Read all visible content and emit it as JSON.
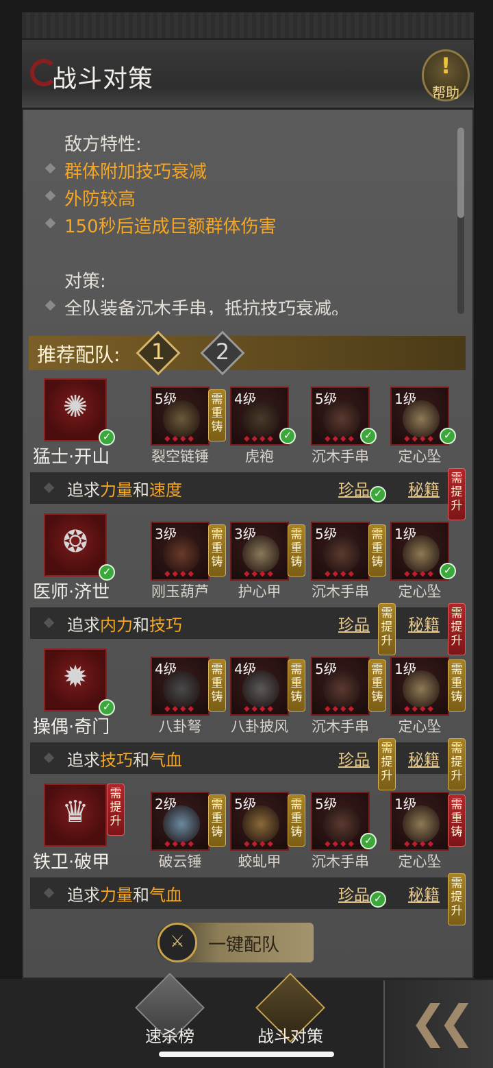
{
  "header": {
    "title": "战斗对策",
    "help_label": "帮助",
    "help_mark": "!"
  },
  "description": {
    "enemy_heading": "敌方特性:",
    "traits": [
      "群体附加技巧衰减",
      "外防较高",
      "150秒后造成巨额群体伤害"
    ],
    "strategy_heading": "对策:",
    "strategies": [
      "全队装备沉木手串，抵抗技巧衰减。"
    ]
  },
  "recommend": {
    "label": "推荐配队:",
    "tabs": [
      "1",
      "2"
    ],
    "active_tab": "1"
  },
  "team": [
    {
      "name": "猛士·开山",
      "glyph": "✺",
      "checked": true,
      "tag": null,
      "equipment": [
        {
          "level": "5级",
          "name": "裂空链锤",
          "tag": "需重铸",
          "tag_color": "gold",
          "checked": false,
          "art": "#6a5a3a"
        },
        {
          "level": "4级",
          "name": "虎袍",
          "tag": null,
          "tag_color": null,
          "checked": true,
          "art": "#4a3a2a"
        },
        {
          "level": "5级",
          "name": "沉木手串",
          "tag": null,
          "tag_color": null,
          "checked": true,
          "art": "#5a3a30"
        },
        {
          "level": "1级",
          "name": "定心坠",
          "tag": null,
          "tag_color": null,
          "checked": true,
          "art": "#8e7a55"
        }
      ],
      "pursuit": {
        "prefix": "追求",
        "stat1": "力量",
        "joiner": "和",
        "stat2": "速度",
        "treasure": "珍品",
        "treasure_tag": null,
        "treasure_checked": true,
        "manual": "秘籍",
        "manual_tag": "需提升",
        "manual_tag_color": "red"
      }
    },
    {
      "name": "医师·济世",
      "glyph": "❂",
      "checked": true,
      "tag": null,
      "equipment": [
        {
          "level": "3级",
          "name": "刚玉葫芦",
          "tag": "需重铸",
          "tag_color": "gold",
          "checked": false,
          "art": "#6a3a2a"
        },
        {
          "level": "3级",
          "name": "护心甲",
          "tag": "需重铸",
          "tag_color": "gold",
          "checked": false,
          "art": "#8a7a5a"
        },
        {
          "level": "5级",
          "name": "沉木手串",
          "tag": "需重铸",
          "tag_color": "gold",
          "checked": false,
          "art": "#5a3a30"
        },
        {
          "level": "1级",
          "name": "定心坠",
          "tag": null,
          "tag_color": null,
          "checked": true,
          "art": "#8e7a55"
        }
      ],
      "pursuit": {
        "prefix": "追求",
        "stat1": "内力",
        "joiner": "和",
        "stat2": "技巧",
        "treasure": "珍品",
        "treasure_tag": "需提升",
        "treasure_checked": false,
        "manual": "秘籍",
        "manual_tag": "需提升",
        "manual_tag_color": "red"
      }
    },
    {
      "name": "操偶·奇门",
      "glyph": "✹",
      "checked": true,
      "tag": null,
      "equipment": [
        {
          "level": "4级",
          "name": "八卦弩",
          "tag": "需重铸",
          "tag_color": "gold",
          "checked": false,
          "art": "#4a4a4a"
        },
        {
          "level": "4级",
          "name": "八卦披风",
          "tag": "需重铸",
          "tag_color": "gold",
          "checked": false,
          "art": "#5a5a5a"
        },
        {
          "level": "5级",
          "name": "沉木手串",
          "tag": "需重铸",
          "tag_color": "gold",
          "checked": false,
          "art": "#5a3a30"
        },
        {
          "level": "1级",
          "name": "定心坠",
          "tag": "需重铸",
          "tag_color": "gold",
          "checked": false,
          "art": "#8e7a55"
        }
      ],
      "pursuit": {
        "prefix": "追求",
        "stat1": "技巧",
        "joiner": "和",
        "stat2": "气血",
        "treasure": "珍品",
        "treasure_tag": "需提升",
        "treasure_checked": false,
        "manual": "秘籍",
        "manual_tag": "需提升",
        "manual_tag_color": "gold"
      }
    },
    {
      "name": "铁卫·破甲",
      "glyph": "♛",
      "checked": false,
      "tag": "需提升",
      "equipment": [
        {
          "level": "2级",
          "name": "破云锤",
          "tag": "需重铸",
          "tag_color": "gold",
          "checked": false,
          "art": "#6a8aa0"
        },
        {
          "level": "5级",
          "name": "蛟虬甲",
          "tag": "需重铸",
          "tag_color": "gold",
          "checked": false,
          "art": "#8a6a3a"
        },
        {
          "level": "5级",
          "name": "沉木手串",
          "tag": null,
          "tag_color": null,
          "checked": true,
          "art": "#5a3a30"
        },
        {
          "level": "1级",
          "name": "定心坠",
          "tag": "需重铸",
          "tag_color": "red",
          "checked": false,
          "art": "#8e7a55"
        }
      ],
      "pursuit": {
        "prefix": "追求",
        "stat1": "力量",
        "joiner": "和",
        "stat2": "气血",
        "treasure": "珍品",
        "treasure_tag": null,
        "treasure_checked": true,
        "manual": "秘籍",
        "manual_tag": "需提升",
        "manual_tag_color": "gold"
      }
    }
  ],
  "auto_button": {
    "label": "一键配队",
    "icon": "shield-sword-icon"
  },
  "bottom_nav": [
    {
      "label": "速杀榜",
      "icon": "scroll-icon",
      "active": false
    },
    {
      "label": "战斗对策",
      "icon": "strategy-character-icon",
      "active": true
    }
  ],
  "back_icon": "double-chevron-left-icon",
  "colors": {
    "accent_orange": "#f5a623",
    "gold": "#a88223",
    "red": "#b3262a",
    "check_green": "#3ca83c"
  }
}
